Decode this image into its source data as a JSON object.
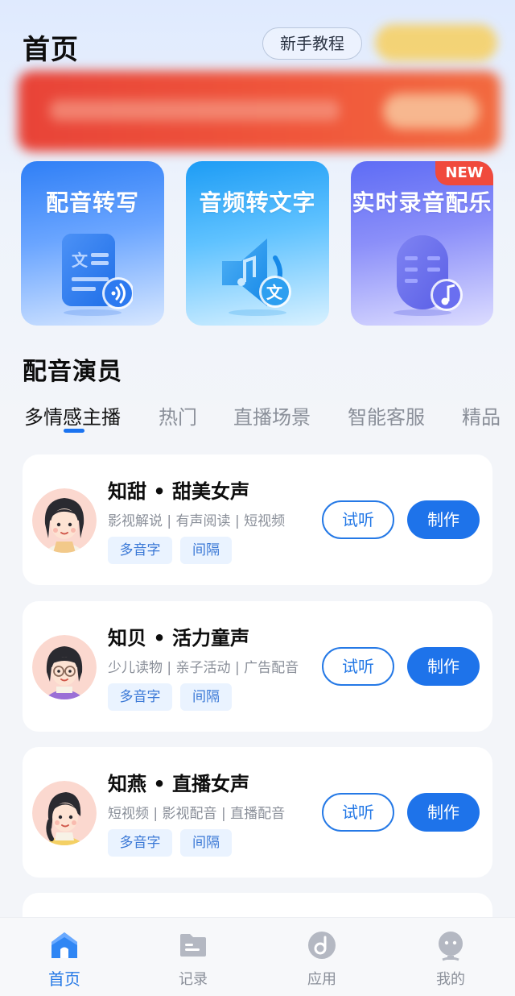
{
  "header": {
    "title": "首页",
    "tutorial_label": "新手教程"
  },
  "features": [
    {
      "label": "配音转写",
      "icon": "document-sound-icon"
    },
    {
      "label": "音频转文字",
      "icon": "speaker-text-icon"
    },
    {
      "label": "实时录音配乐",
      "icon": "microphone-music-icon",
      "badge": "NEW"
    }
  ],
  "section": {
    "title": "配音演员"
  },
  "tabs": [
    "多情感主播",
    "热门",
    "直播场景",
    "智能客服",
    "精品"
  ],
  "voices": [
    {
      "name": "知甜 • 甜美女声",
      "tags": "影视解说 | 有声阅读 | 短视频",
      "chips": [
        "多音字",
        "间隔"
      ],
      "listen": "试听",
      "make": "制作"
    },
    {
      "name": "知贝 • 活力童声",
      "tags": "少儿读物 | 亲子活动 | 广告配音",
      "chips": [
        "多音字",
        "间隔"
      ],
      "listen": "试听",
      "make": "制作"
    },
    {
      "name": "知燕 • 直播女声",
      "tags": "短视频 | 影视配音 | 直播配音",
      "chips": [
        "多音字",
        "间隔"
      ],
      "listen": "试听",
      "make": "制作"
    }
  ],
  "bottom_nav": [
    {
      "label": "首页",
      "icon": "home-icon",
      "active": true
    },
    {
      "label": "记录",
      "icon": "folder-icon",
      "active": false
    },
    {
      "label": "应用",
      "icon": "apps-icon",
      "active": false
    },
    {
      "label": "我的",
      "icon": "profile-icon",
      "active": false
    }
  ],
  "colors": {
    "accent": "#1e73ea",
    "new_badge": "#f04a3c",
    "chip_bg": "#eaf3ff"
  }
}
